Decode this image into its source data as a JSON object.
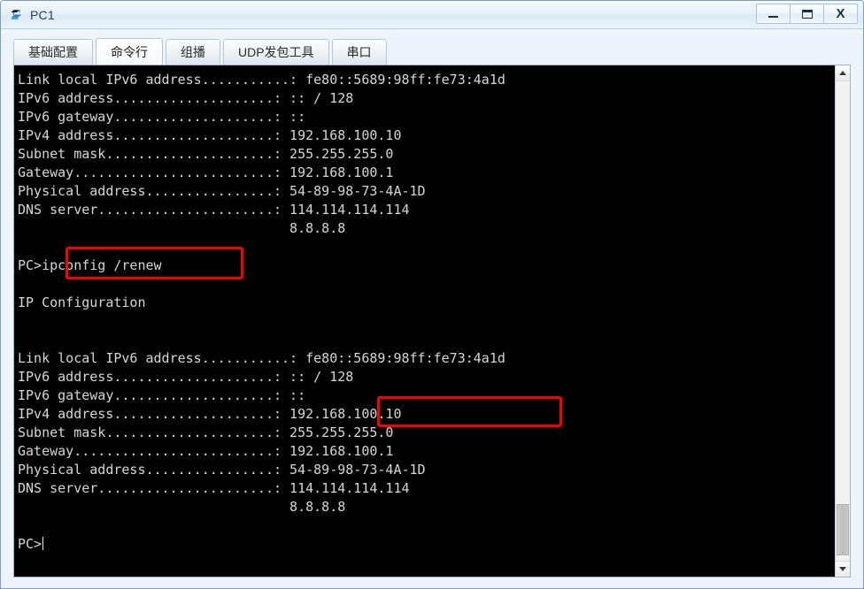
{
  "window": {
    "title": "PC1",
    "icon": "pc-device-icon",
    "controls": {
      "minimize_label": "–",
      "maximize_label": "☐",
      "close_label": "X"
    }
  },
  "tabs": [
    {
      "label": "基础配置",
      "name": "tab-basic-config",
      "active": false
    },
    {
      "label": "命令行",
      "name": "tab-command-line",
      "active": true
    },
    {
      "label": "组播",
      "name": "tab-multicast",
      "active": false
    },
    {
      "label": "UDP发包工具",
      "name": "tab-udp-tool",
      "active": false
    },
    {
      "label": "串口",
      "name": "tab-serial-port",
      "active": false
    }
  ],
  "terminal": {
    "prompt": "PC>",
    "command": "ipconfig /renew",
    "section_header": "IP Configuration",
    "cursor_visible": true,
    "text": "Link local IPv6 address...........: fe80::5689:98ff:fe73:4a1d\nIPv6 address....................: :: / 128\nIPv6 gateway....................: ::\nIPv4 address....................: 192.168.100.10\nSubnet mask.....................: 255.255.255.0\nGateway.........................: 192.168.100.1\nPhysical address................: 54-89-98-73-4A-1D\nDNS server......................: 114.114.114.114\n                                  8.8.8.8\n\nPC>ipconfig /renew\n\nIP Configuration\n\n\nLink local IPv6 address...........: fe80::5689:98ff:fe73:4a1d\nIPv6 address....................: :: / 128\nIPv6 gateway....................: ::\nIPv4 address....................: 192.168.100.10\nSubnet mask.....................: 255.255.255.0\nGateway.........................: 192.168.100.1\nPhysical address................: 54-89-98-73-4A-1D\nDNS server......................: 114.114.114.114\n                                  8.8.8.8\n\nPC>",
    "blocks": [
      {
        "rows": [
          {
            "label": "Link local IPv6 address",
            "value": "fe80::5689:98ff:fe73:4a1d"
          },
          {
            "label": "IPv6 address",
            "value": ":: / 128"
          },
          {
            "label": "IPv6 gateway",
            "value": "::"
          },
          {
            "label": "IPv4 address",
            "value": "192.168.100.10"
          },
          {
            "label": "Subnet mask",
            "value": "255.255.255.0"
          },
          {
            "label": "Gateway",
            "value": "192.168.100.1"
          },
          {
            "label": "Physical address",
            "value": "54-89-98-73-4A-1D"
          },
          {
            "label": "DNS server",
            "value": "114.114.114.114"
          },
          {
            "label": "",
            "value": "8.8.8.8"
          }
        ]
      },
      {
        "rows": [
          {
            "label": "Link local IPv6 address",
            "value": "fe80::5689:98ff:fe73:4a1d"
          },
          {
            "label": "IPv6 address",
            "value": ":: / 128"
          },
          {
            "label": "IPv6 gateway",
            "value": "::"
          },
          {
            "label": "IPv4 address",
            "value": "192.168.100.10"
          },
          {
            "label": "Subnet mask",
            "value": "255.255.255.0"
          },
          {
            "label": "Gateway",
            "value": "192.168.100.1"
          },
          {
            "label": "Physical address",
            "value": "54-89-98-73-4A-1D"
          },
          {
            "label": "DNS server",
            "value": "114.114.114.114"
          },
          {
            "label": "",
            "value": "8.8.8.8"
          }
        ]
      }
    ]
  },
  "annotations": [
    {
      "name": "highlight-command",
      "target": "ipconfig /renew",
      "color": "#f50000"
    },
    {
      "name": "highlight-ipv4-address",
      "target": "192.168.100.10",
      "color": "#f50000"
    }
  ],
  "scrollbar": {
    "up_arrow": "scroll-up-icon",
    "down_arrow": "scroll-down-icon"
  },
  "colors": {
    "terminal_bg": "#000000",
    "terminal_fg": "#d6d6d6",
    "annotation": "#f50000",
    "window_bg": "#eef4fb",
    "title_fg": "#1b3f6b"
  }
}
